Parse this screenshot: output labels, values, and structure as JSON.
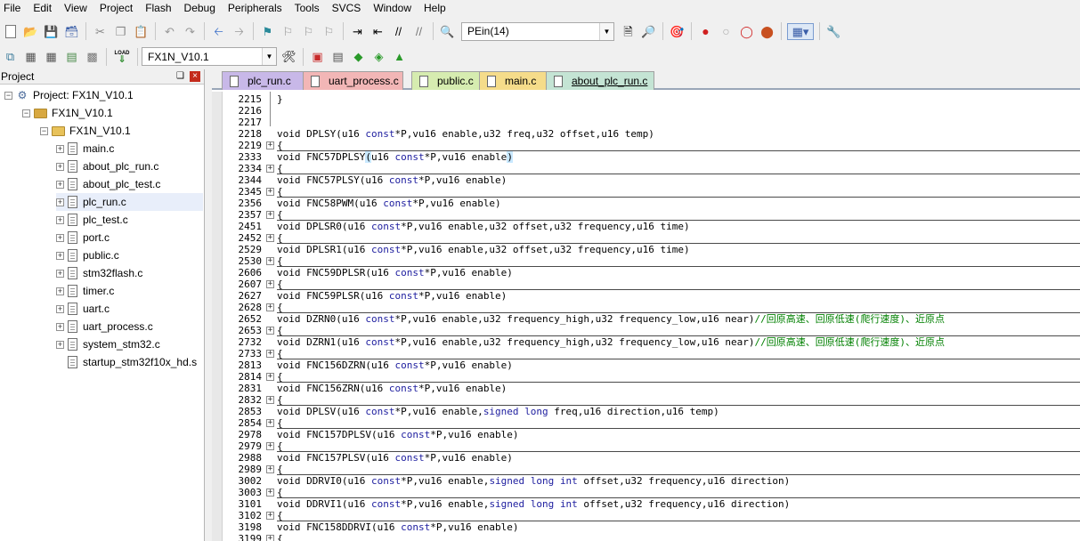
{
  "menubar": [
    "File",
    "Edit",
    "View",
    "Project",
    "Flash",
    "Debug",
    "Peripherals",
    "Tools",
    "SVCS",
    "Window",
    "Help"
  ],
  "toolbar1": {
    "find_combo_value": "PEin(14)"
  },
  "toolbar2": {
    "target_combo_value": "FX1N_V10.1",
    "load_label": "LOAD"
  },
  "project_panel": {
    "title": "Project",
    "pin_glyph": "❑",
    "close_glyph": "×",
    "tree": [
      {
        "label": "Project: FX1N_V10.1",
        "level": 0,
        "kind": "project",
        "expander": "-"
      },
      {
        "label": "FX1N_V10.1",
        "level": 1,
        "kind": "target",
        "expander": "-"
      },
      {
        "label": "FX1N_V10.1",
        "level": 2,
        "kind": "folder",
        "expander": "-"
      },
      {
        "label": "main.c",
        "level": 3,
        "kind": "file",
        "expander": "+"
      },
      {
        "label": "about_plc_run.c",
        "level": 3,
        "kind": "file",
        "expander": "+"
      },
      {
        "label": "about_plc_test.c",
        "level": 3,
        "kind": "file",
        "expander": "+"
      },
      {
        "label": "plc_run.c",
        "level": 3,
        "kind": "file",
        "expander": "+",
        "selected": true
      },
      {
        "label": "plc_test.c",
        "level": 3,
        "kind": "file",
        "expander": "+"
      },
      {
        "label": "port.c",
        "level": 3,
        "kind": "file",
        "expander": "+"
      },
      {
        "label": "public.c",
        "level": 3,
        "kind": "file",
        "expander": "+"
      },
      {
        "label": "stm32flash.c",
        "level": 3,
        "kind": "file",
        "expander": "+"
      },
      {
        "label": "timer.c",
        "level": 3,
        "kind": "file",
        "expander": "+"
      },
      {
        "label": "uart.c",
        "level": 3,
        "kind": "file",
        "expander": "+"
      },
      {
        "label": "uart_process.c",
        "level": 3,
        "kind": "file",
        "expander": "+"
      },
      {
        "label": "system_stm32.c",
        "level": 3,
        "kind": "file",
        "expander": "+"
      },
      {
        "label": "startup_stm32f10x_hd.s",
        "level": 3,
        "kind": "file",
        "expander": ""
      }
    ]
  },
  "tabs": [
    {
      "label": "plc_run.c",
      "color": "#c8b8e8",
      "active": false
    },
    {
      "label": "uart_process.c",
      "color": "#f2b6b6",
      "active": false
    },
    {
      "label": "public.c",
      "color": "#d6ecb0",
      "active": false
    },
    {
      "label": "main.c",
      "color": "#f5dc8a",
      "active": false
    },
    {
      "label": "about_plc_run.c",
      "color": "#c4e4d4",
      "active": true
    }
  ],
  "code_lines": [
    {
      "n": "2215",
      "fold": "",
      "text": "}"
    },
    {
      "n": "2216",
      "fold": "",
      "text": ""
    },
    {
      "n": "2217",
      "fold": "",
      "text": ""
    },
    {
      "n": "2218",
      "fold": "",
      "text": "void DPLSY(u16 const*P,vu16 enable,u32 freq,u32 offset,u16 temp)"
    },
    {
      "n": "2219",
      "fold": "+",
      "text": "{"
    },
    {
      "n": "2333",
      "fold": "",
      "text": "void FNC57DPLSY(u16 const*P,vu16 enable)"
    },
    {
      "n": "2334",
      "fold": "+",
      "text": "{"
    },
    {
      "n": "2344",
      "fold": "",
      "text": "void FNC57PLSY(u16 const*P,vu16 enable)"
    },
    {
      "n": "2345",
      "fold": "+",
      "text": "{"
    },
    {
      "n": "2356",
      "fold": "",
      "text": "void FNC58PWM(u16 const*P,vu16 enable)"
    },
    {
      "n": "2357",
      "fold": "+",
      "text": "{"
    },
    {
      "n": "2451",
      "fold": "",
      "text": "void DPLSR0(u16 const*P,vu16 enable,u32 offset,u32 frequency,u16 time)"
    },
    {
      "n": "2452",
      "fold": "+",
      "text": "{"
    },
    {
      "n": "2529",
      "fold": "",
      "text": "void DPLSR1(u16 const*P,vu16 enable,u32 offset,u32 frequency,u16 time)"
    },
    {
      "n": "2530",
      "fold": "+",
      "text": "{"
    },
    {
      "n": "2606",
      "fold": "",
      "text": "void FNC59DPLSR(u16 const*P,vu16 enable)"
    },
    {
      "n": "2607",
      "fold": "+",
      "text": "{"
    },
    {
      "n": "2627",
      "fold": "",
      "text": "void FNC59PLSR(u16 const*P,vu16 enable)"
    },
    {
      "n": "2628",
      "fold": "+",
      "text": "{"
    },
    {
      "n": "2652",
      "fold": "",
      "text": "void DZRN0(u16 const*P,vu16 enable,u32 frequency_high,u32 frequency_low,u16 near)",
      "comment": "//回原高速、回原低速(爬行速度)、近原点"
    },
    {
      "n": "2653",
      "fold": "+",
      "text": "{"
    },
    {
      "n": "2732",
      "fold": "",
      "text": "void DZRN1(u16 const*P,vu16 enable,u32 frequency_high,u32 frequency_low,u16 near)",
      "comment": "//回原高速、回原低速(爬行速度)、近原点"
    },
    {
      "n": "2733",
      "fold": "+",
      "text": "{"
    },
    {
      "n": "2813",
      "fold": "",
      "text": "void FNC156DZRN(u16 const*P,vu16 enable)"
    },
    {
      "n": "2814",
      "fold": "+",
      "text": "{"
    },
    {
      "n": "2831",
      "fold": "",
      "text": "void FNC156ZRN(u16 const*P,vu16 enable)"
    },
    {
      "n": "2832",
      "fold": "+",
      "text": "{"
    },
    {
      "n": "2853",
      "fold": "",
      "text": "void DPLSV(u16 const*P,vu16 enable,signed long freq,u16 direction,u16 temp)"
    },
    {
      "n": "2854",
      "fold": "+",
      "text": "{"
    },
    {
      "n": "2978",
      "fold": "",
      "text": "void FNC157DPLSV(u16 const*P,vu16 enable)"
    },
    {
      "n": "2979",
      "fold": "+",
      "text": "{"
    },
    {
      "n": "2988",
      "fold": "",
      "text": "void FNC157PLSV(u16 const*P,vu16 enable)"
    },
    {
      "n": "2989",
      "fold": "+",
      "text": "{"
    },
    {
      "n": "3002",
      "fold": "",
      "text": "void DDRVI0(u16 const*P,vu16 enable,signed long int offset,u32 frequency,u16 direction)"
    },
    {
      "n": "3003",
      "fold": "+",
      "text": "{"
    },
    {
      "n": "3101",
      "fold": "",
      "text": "void DDRVI1(u16 const*P,vu16 enable,signed long int offset,u32 frequency,u16 direction)"
    },
    {
      "n": "3102",
      "fold": "+",
      "text": "{"
    },
    {
      "n": "3198",
      "fold": "",
      "text": "void FNC158DDRVI(u16 const*P,vu16 enable)"
    },
    {
      "n": "3199",
      "fold": "+",
      "text": "{"
    }
  ]
}
